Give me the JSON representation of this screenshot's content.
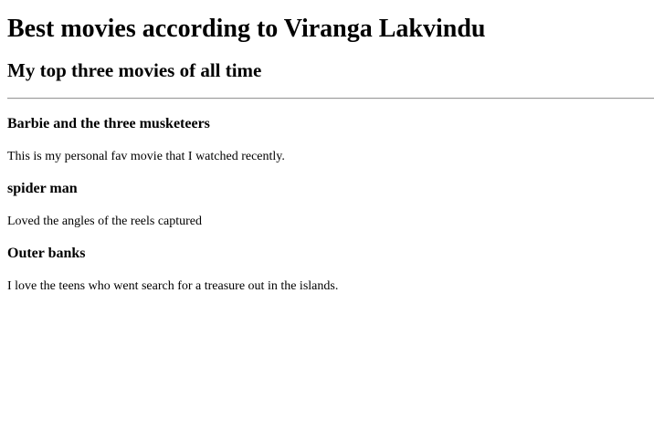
{
  "page": {
    "title": "Best movies according to Viranga Lakvindu",
    "subtitle": "My top three movies of all time"
  },
  "movies": [
    {
      "title": "Barbie and the three musketeers",
      "description": "This is my personal fav movie that I watched recently."
    },
    {
      "title": "spider man",
      "description": "Loved the angles of the reels captured"
    },
    {
      "title": "Outer banks",
      "description": "I love the teens who went search for a treasure out in the islands."
    }
  ]
}
